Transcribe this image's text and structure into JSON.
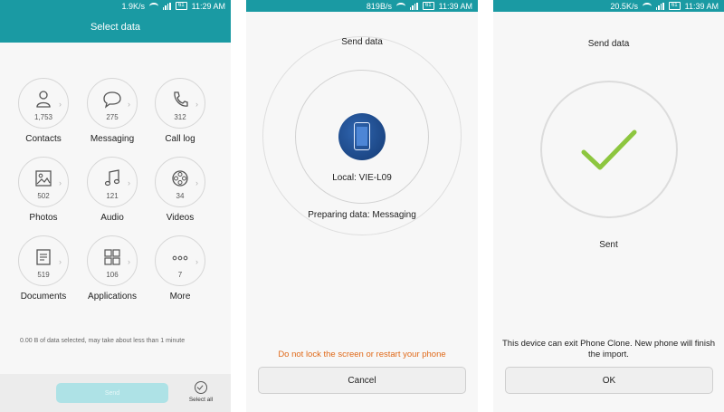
{
  "screen1": {
    "status": {
      "speed": "1.9K/s",
      "battery": "61",
      "time": "11:29 AM"
    },
    "title": "Select data",
    "items": [
      {
        "label": "Contacts",
        "count": "1,753",
        "icon": "contact-icon"
      },
      {
        "label": "Messaging",
        "count": "275",
        "icon": "message-bubble-icon"
      },
      {
        "label": "Call log",
        "count": "312",
        "icon": "phone-handset-icon"
      },
      {
        "label": "Photos",
        "count": "502",
        "icon": "image-icon"
      },
      {
        "label": "Audio",
        "count": "121",
        "icon": "music-note-icon"
      },
      {
        "label": "Videos",
        "count": "34",
        "icon": "film-reel-icon"
      },
      {
        "label": "Documents",
        "count": "519",
        "icon": "document-icon"
      },
      {
        "label": "Applications",
        "count": "106",
        "icon": "apps-grid-icon"
      },
      {
        "label": "More",
        "count": "7",
        "icon": "more-dots-icon"
      }
    ],
    "info": "0.00 B of data selected, may take about less than 1 minute",
    "send_label": "Send",
    "select_all_label": "Select all"
  },
  "screen2": {
    "status": {
      "speed": "819B/s",
      "battery": "61",
      "time": "11:39 AM"
    },
    "heading": "Send data",
    "device": "Local: VIE-L09",
    "progress": "Preparing data: Messaging",
    "warning": "Do not lock the screen or restart your phone",
    "cancel_label": "Cancel"
  },
  "screen3": {
    "status": {
      "speed": "20.5K/s",
      "battery": "61",
      "time": "11:39 AM"
    },
    "heading": "Send data",
    "sent": "Sent",
    "message_line1": "This device can exit Phone Clone. New phone will finish",
    "message_line2": "the import.",
    "ok_label": "OK"
  },
  "colors": {
    "accent": "#1a9aa3",
    "check": "#8dc63f",
    "warning": "#e06a1a",
    "phone": "#1f4f99"
  }
}
